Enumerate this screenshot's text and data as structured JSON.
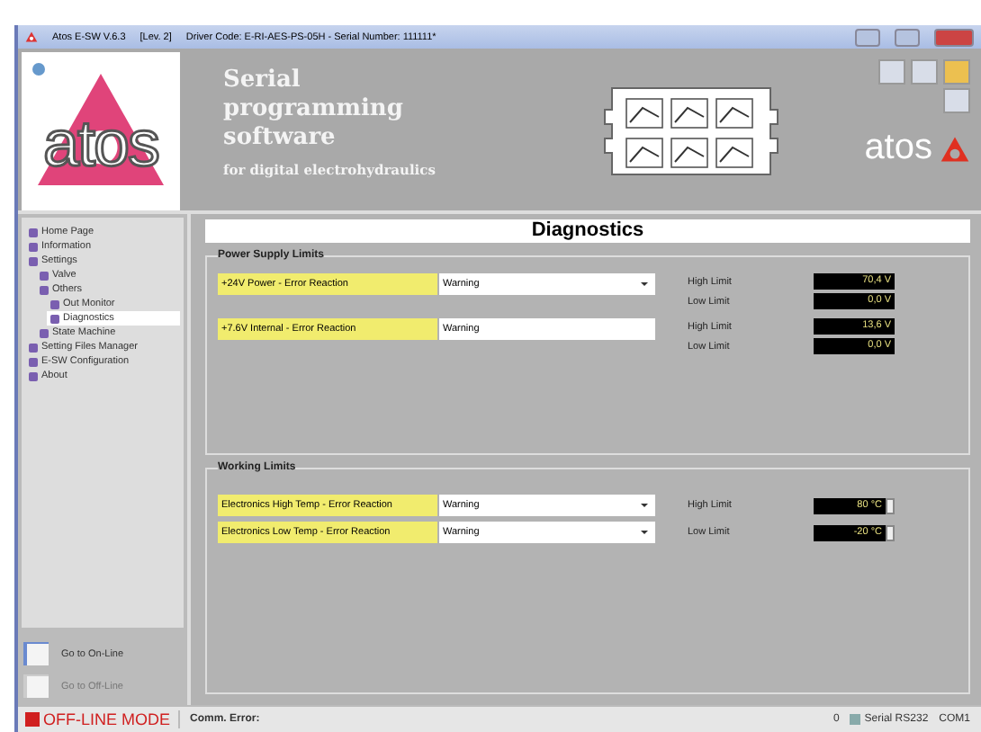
{
  "window": {
    "title": "Atos E-SW V.6.3",
    "level": "[Lev. 2]",
    "driver": "Driver Code: E-RI-AES-PS-05H - Serial Number: 111111*"
  },
  "header": {
    "logo_text": "atos",
    "title_lines": [
      "Serial",
      "programming",
      "software"
    ],
    "subtitle": "for digital electrohydraulics",
    "brand": "atos"
  },
  "sidebar": {
    "items": [
      {
        "label": "Home Page",
        "selected": false
      },
      {
        "label": "Information",
        "selected": false
      },
      {
        "label": "Settings",
        "selected": false,
        "children": [
          {
            "label": "Valve",
            "selected": false
          },
          {
            "label": "Others",
            "selected": false,
            "children": [
              {
                "label": "Out Monitor",
                "selected": false
              },
              {
                "label": "Diagnostics",
                "selected": true
              }
            ]
          },
          {
            "label": "State Machine",
            "selected": false
          }
        ]
      },
      {
        "label": "Setting Files Manager",
        "selected": false
      },
      {
        "label": "E-SW Configuration",
        "selected": false
      },
      {
        "label": "About",
        "selected": false
      }
    ],
    "buttons": [
      {
        "label": "Go to On-Line",
        "disabled": false
      },
      {
        "label": "Go to Off-Line",
        "disabled": true
      }
    ]
  },
  "page_title": "Diagnostics",
  "power_supply": {
    "title": "Power Supply Limits",
    "rows": [
      {
        "label": "+24V Power - Error Reaction",
        "value": "Warning",
        "kind": "dropdown",
        "high_label": "High Limit",
        "high": "70,4 V",
        "low_label": "Low Limit",
        "low": "0,0 V"
      },
      {
        "label": "+7.6V Internal - Error Reaction",
        "value": "Warning",
        "kind": "text",
        "high_label": "High Limit",
        "high": "13,6 V",
        "low_label": "Low Limit",
        "low": "0,0 V"
      }
    ]
  },
  "working_limits": {
    "title": "Working Limits",
    "rows": [
      {
        "label": "Electronics High Temp - Error Reaction",
        "value": "Warning",
        "limit_label": "High Limit",
        "limit": "80 °C"
      },
      {
        "label": "Electronics Low Temp - Error Reaction",
        "value": "Warning",
        "limit_label": "Low Limit",
        "limit": "-20 °C"
      }
    ]
  },
  "status_bar": {
    "mode": "OFF-LINE MODE",
    "comm": "Comm. Error:",
    "count": "0",
    "port_type": "Serial RS232",
    "port": "COM1"
  }
}
